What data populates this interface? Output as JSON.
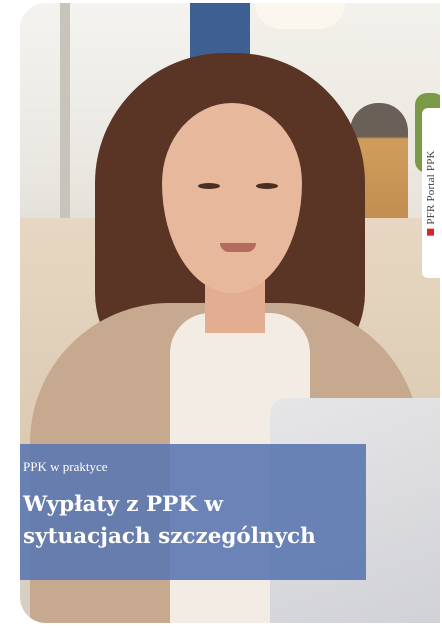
{
  "card": {
    "category": "PPK w praktyce",
    "title_line_1": "Wypłaty z PPK w",
    "title_line_2": "sytuacjach szczególnych",
    "side_tab_label": "PFR Portal PPK"
  },
  "colors": {
    "overlay": "#5c78b0",
    "side_tab_mark": "#d8232a"
  },
  "icons": {
    "side_tab_logo": "pfr-logo-mark"
  }
}
